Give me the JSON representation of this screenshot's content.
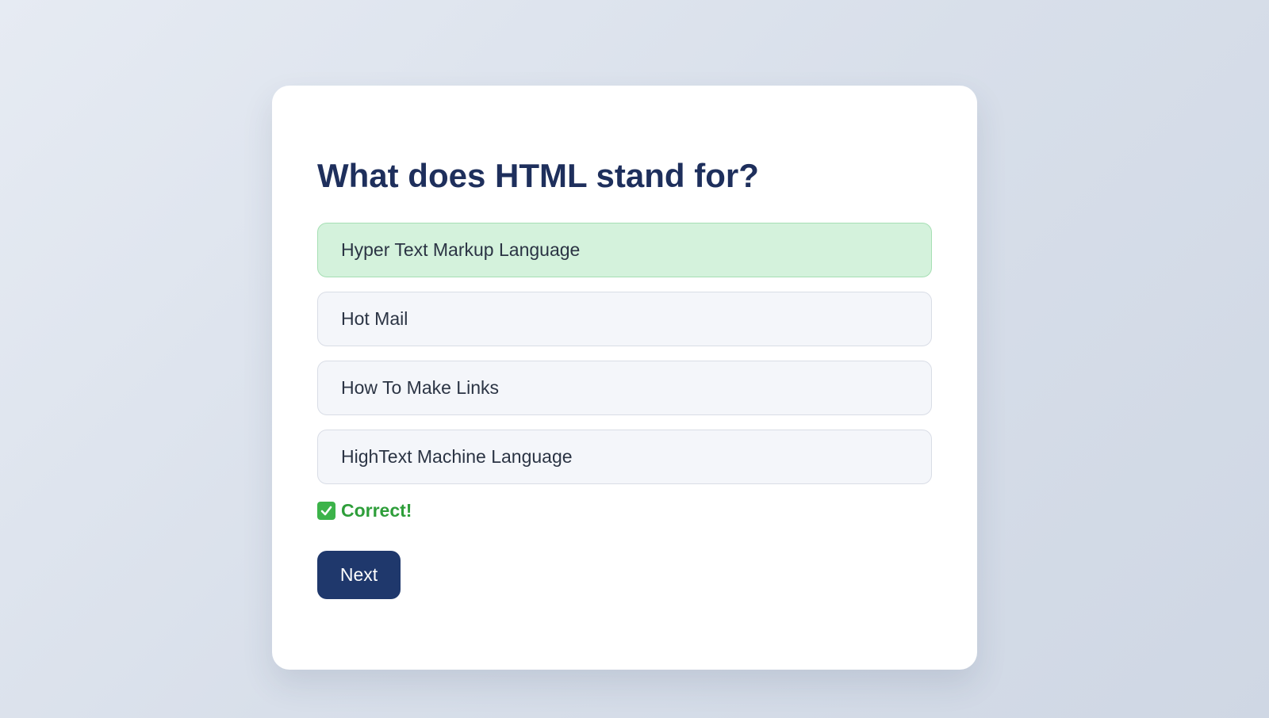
{
  "quiz": {
    "question": "What does HTML stand for?",
    "options": [
      {
        "label": "Hyper Text Markup Language",
        "state": "correct"
      },
      {
        "label": "Hot Mail",
        "state": "default"
      },
      {
        "label": "How To Make Links",
        "state": "default"
      },
      {
        "label": "HighText Machine Language",
        "state": "default"
      }
    ],
    "feedback": {
      "icon": "check-mark-icon",
      "text": "Correct!",
      "color": "#2e9e3a"
    },
    "next_label": "Next"
  },
  "colors": {
    "accent": "#1f386c",
    "correct_bg": "#d4f2dc",
    "title": "#1e2f5c"
  }
}
